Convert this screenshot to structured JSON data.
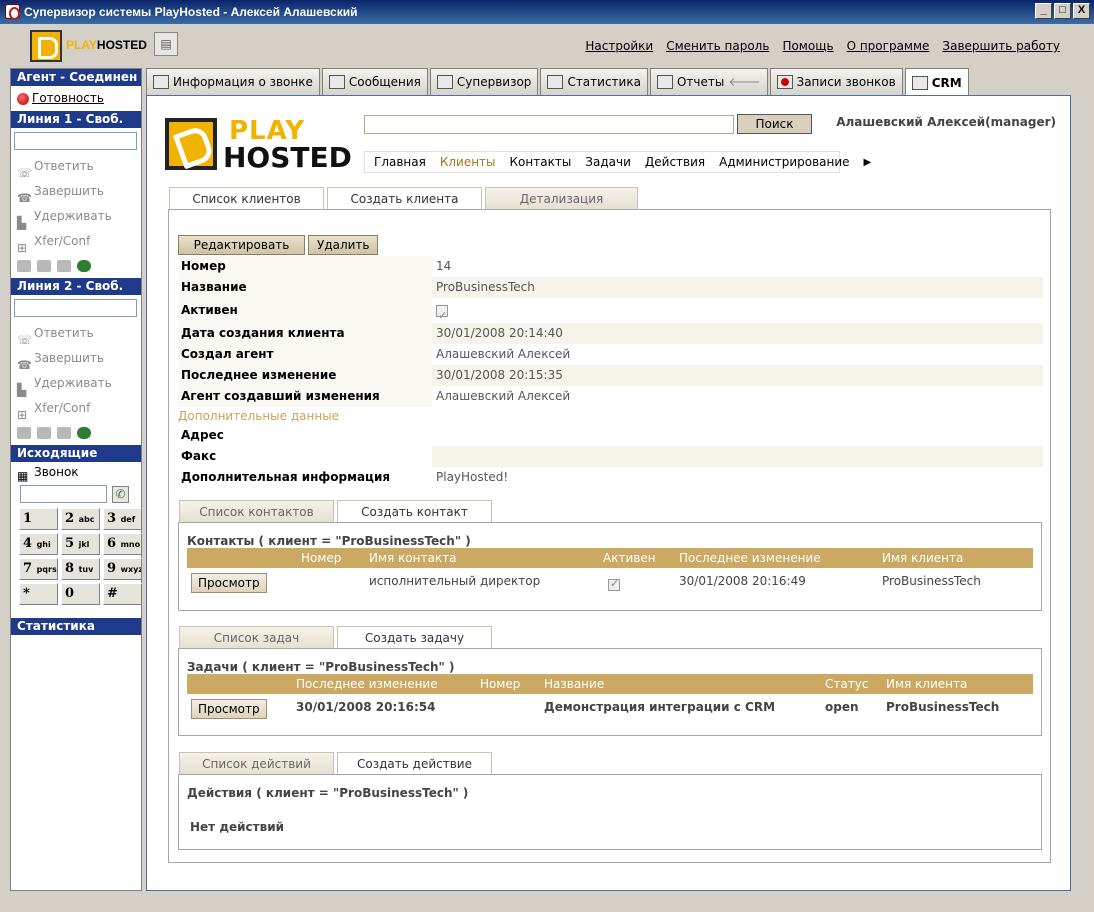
{
  "window": {
    "title": "Супервизор системы PlayHosted - Алексей Алашевский",
    "buttons": [
      "_",
      "□",
      "X"
    ]
  },
  "topbar": {
    "logo_play": "PLAY",
    "logo_hosted": "HOSTED",
    "links": [
      "Настройки",
      "Сменить пароль",
      "Помощь",
      "О программе",
      "Завершить работу"
    ]
  },
  "left": {
    "agent_header": "Агент - Соединен",
    "ready": "Готовность",
    "line1_header": "Линия 1 - Своб.",
    "line2_header": "Линия 2 - Своб.",
    "line_actions": [
      "Ответить",
      "Завершить",
      "Удерживать",
      "Xfer/Conf"
    ],
    "outgoing_header": "Исходящие",
    "call_label": "Звонок",
    "keys": [
      {
        "d": "1",
        "l": ""
      },
      {
        "d": "2",
        "l": "abc"
      },
      {
        "d": "3",
        "l": "def"
      },
      {
        "d": "4",
        "l": "ghi"
      },
      {
        "d": "5",
        "l": "jkl"
      },
      {
        "d": "6",
        "l": "mno"
      },
      {
        "d": "7",
        "l": "pqrs"
      },
      {
        "d": "8",
        "l": "tuv"
      },
      {
        "d": "9",
        "l": "wxyz"
      },
      {
        "d": "*",
        "l": ""
      },
      {
        "d": "0",
        "l": ""
      },
      {
        "d": "#",
        "l": ""
      }
    ],
    "stats_header": "Статистика"
  },
  "tabs": [
    "Информация о звонке",
    "Сообщения",
    "Супервизор",
    "Статистика",
    "Отчеты",
    "Записи звонков",
    "CRM"
  ],
  "crm": {
    "logo_play": "PLAY",
    "logo_hosted": "HOSTED",
    "search_value": "",
    "search_button": "Поиск",
    "user": "Алашевский Алексей(manager)",
    "nav": [
      "Главная",
      "Клиенты",
      "Контакты",
      "Задачи",
      "Действия",
      "Администрирование"
    ],
    "nav_active": "Клиенты",
    "client_tabs": [
      "Список клиентов",
      "Создать клиента",
      "Детализация"
    ],
    "edit_button": "Редактировать",
    "delete_button": "Удалить",
    "fields": [
      {
        "label": "Номер",
        "value": "14"
      },
      {
        "label": "Название",
        "value": "ProBusinessTech"
      },
      {
        "label": "Активен",
        "value": ""
      },
      {
        "label": "Дата создания клиента",
        "value": "30/01/2008 20:14:40"
      },
      {
        "label": "Создал агент",
        "value": "Алашевский Алексей"
      },
      {
        "label": "Последнее изменение",
        "value": "30/01/2008 20:15:35"
      },
      {
        "label": "Агент создавший изменения",
        "value": "Алашевский Алексей"
      }
    ],
    "extra_header": "Дополнительные данные",
    "extra_fields": [
      {
        "label": "Адрес",
        "value": ""
      },
      {
        "label": "Факс",
        "value": ""
      },
      {
        "label": "Дополнительная информация",
        "value": "PlayHosted!"
      }
    ],
    "contacts": {
      "tabs": [
        "Список контактов",
        "Создать контакт"
      ],
      "title": "Контакты ( клиент = \"ProBusinessTech\" )",
      "columns": [
        "Номер",
        "Имя контакта",
        "Активен",
        "Последнее изменение",
        "Имя клиента"
      ],
      "view_button": "Просмотр",
      "row": {
        "name": "исполнительный директор",
        "changed": "30/01/2008 20:16:49",
        "client": "ProBusinessTech"
      }
    },
    "tasks": {
      "tabs": [
        "Список задач",
        "Создать задачу"
      ],
      "title": "Задачи ( клиент = \"ProBusinessTech\" )",
      "columns": [
        "Послeднее изменение",
        "Номер",
        "Название",
        "Статус",
        "Имя клиента"
      ],
      "view_button": "Просмотр",
      "row": {
        "changed": "30/01/2008 20:16:54",
        "name": "Демонстрация интеграции с CRM",
        "status": "open",
        "client": "ProBusinessTech"
      }
    },
    "actions": {
      "tabs": [
        "Список действий",
        "Создать действие"
      ],
      "title": "Действия ( клиент = \"ProBusinessTech\" )",
      "empty": "Нет действий"
    }
  }
}
